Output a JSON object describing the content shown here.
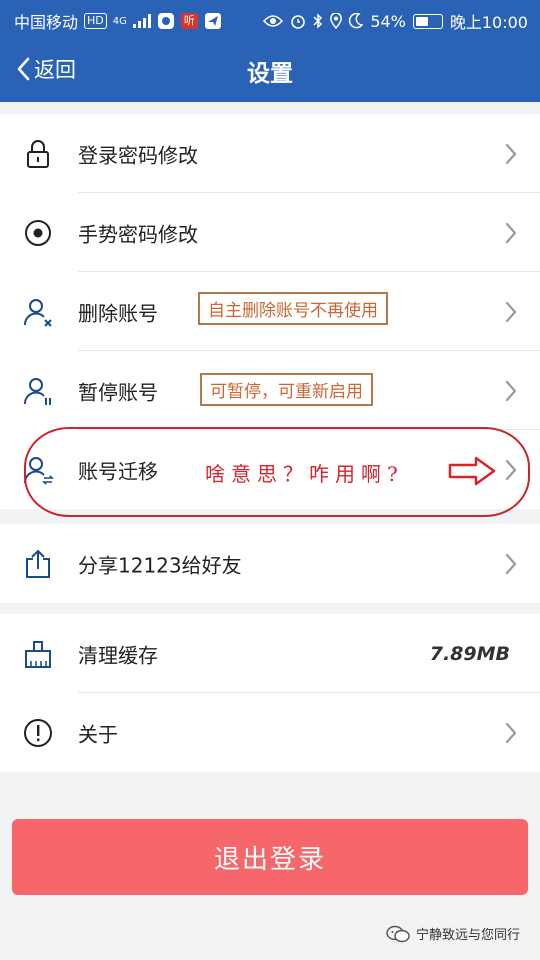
{
  "status_bar": {
    "carrier": "中国移动",
    "hd_badge": "HD",
    "network": "4G",
    "app_badge": "听",
    "battery": "54%",
    "battery_level": 0.54,
    "time": "晚上10:00"
  },
  "nav": {
    "back_label": "返回",
    "title": "设置"
  },
  "rows": {
    "login_password": "登录密码修改",
    "gesture_password": "手势密码修改",
    "delete_account": "删除账号",
    "suspend_account": "暂停账号",
    "migrate_account": "账号迁移",
    "share": "分享12123给好友",
    "clear_cache": "清理缓存",
    "cache_size": "7.89MB",
    "about": "关于"
  },
  "annotations": {
    "delete_note": "自主删除账号不再使用",
    "suspend_note": "可暂停，可重新启用",
    "migrate_note": "啥意思？咋用啊?"
  },
  "logout_label": "退出登录",
  "watermark": "宁静致远与您同行",
  "colors": {
    "header": "#2a63b6",
    "logout": "#f5676b",
    "annotation_red": "#d8232a",
    "annotation_brown": "#b07a4a"
  }
}
